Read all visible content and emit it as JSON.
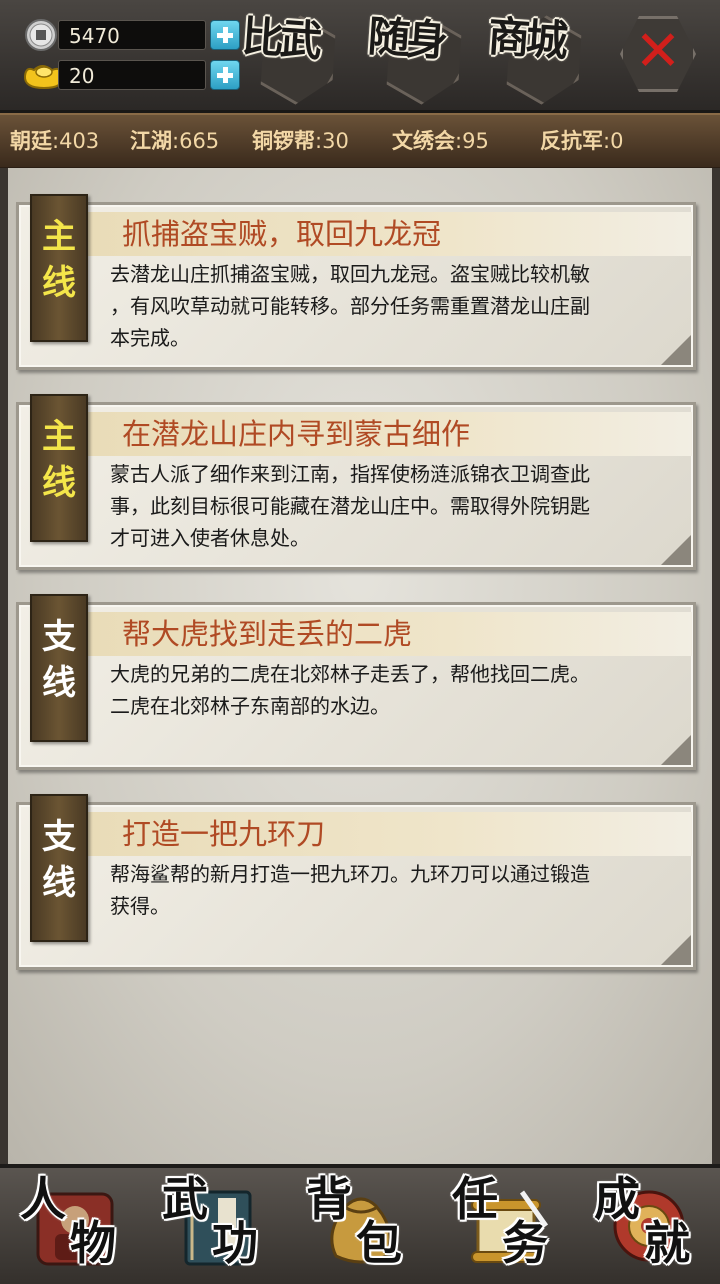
{
  "currencies": [
    {
      "name": "silver-coin",
      "value": "5470",
      "icon": "silver-coin-icon"
    },
    {
      "name": "gold-ingot",
      "value": "20",
      "icon": "gold-ingot-icon"
    }
  ],
  "top_buttons": [
    {
      "label": "比武"
    },
    {
      "label": "随身"
    },
    {
      "label": "商城"
    }
  ],
  "close_label": "✕",
  "factions": [
    {
      "name": "朝廷",
      "value": "403"
    },
    {
      "name": "江湖",
      "value": "665"
    },
    {
      "name": "铜锣帮",
      "value": "30"
    },
    {
      "name": "文绣会",
      "value": "95"
    },
    {
      "name": "反抗军",
      "value": "0"
    }
  ],
  "quests": [
    {
      "tag": [
        "主",
        "线"
      ],
      "type": "main",
      "title": "抓捕盗宝贼，取回九龙冠",
      "desc_lines": [
        "去潜龙山庄抓捕盗宝贼，取回九龙冠。盗宝贼比较机敏",
        "，有风吹草动就可能转移。部分任务需重置潜龙山庄副",
        "本完成。"
      ]
    },
    {
      "tag": [
        "主",
        "线"
      ],
      "type": "main",
      "title": "在潜龙山庄内寻到蒙古细作",
      "desc_lines": [
        "蒙古人派了细作来到江南，指挥使杨涟派锦衣卫调查此",
        "事，此刻目标很可能藏在潜龙山庄中。需取得外院钥匙",
        "才可进入使者休息处。"
      ]
    },
    {
      "tag": [
        "支",
        "线"
      ],
      "type": "side",
      "title": "帮大虎找到走丢的二虎",
      "desc_lines": [
        "大虎的兄弟的二虎在北郊林子走丢了，帮他找回二虎。",
        "二虎在北郊林子东南部的水边。"
      ]
    },
    {
      "tag": [
        "支",
        "线"
      ],
      "type": "side",
      "title": "打造一把九环刀",
      "desc_lines": [
        "帮海鲨帮的新月打造一把九环刀。九环刀可以通过锻造",
        "获得。"
      ]
    }
  ],
  "bottom_nav": [
    {
      "c1": "人",
      "c2": "物",
      "icon": "character-icon"
    },
    {
      "c1": "武",
      "c2": "功",
      "icon": "martial-arts-book-icon"
    },
    {
      "c1": "背",
      "c2": "包",
      "icon": "bag-icon"
    },
    {
      "c1": "任",
      "c2": "务",
      "icon": "quest-scroll-icon"
    },
    {
      "c1": "成",
      "c2": "就",
      "icon": "achievement-icon"
    }
  ],
  "colors": {
    "quest_title": "#b04a24",
    "main_tag_text": "#f4e64a",
    "side_tag_text": "#ffffff",
    "faction_text": "#f2d7a6",
    "close_x": "#d21f1b"
  }
}
